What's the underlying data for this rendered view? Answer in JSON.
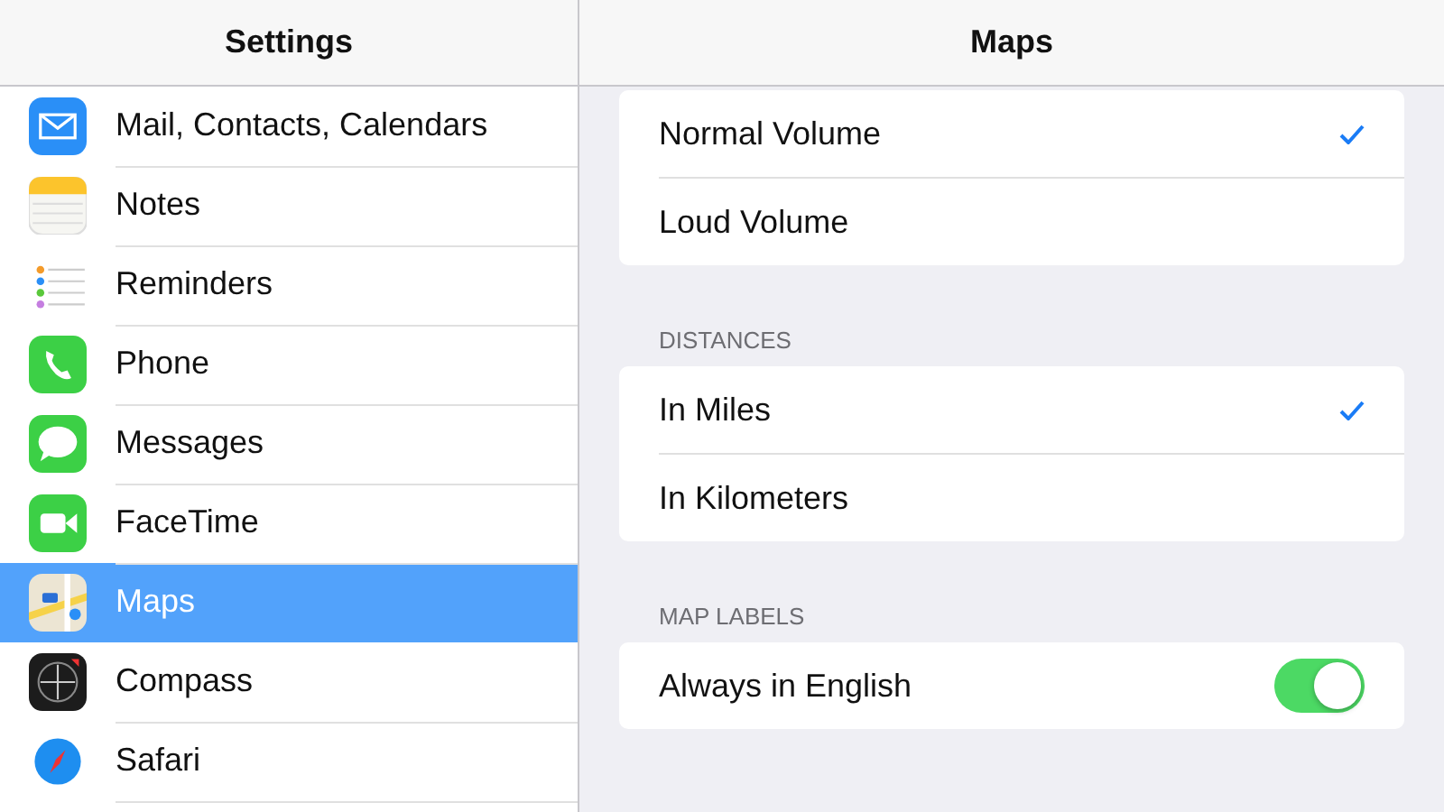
{
  "sidebar": {
    "title": "Settings",
    "items": [
      {
        "label": "Mail, Contacts, Calendars",
        "selected": false
      },
      {
        "label": "Notes",
        "selected": false
      },
      {
        "label": "Reminders",
        "selected": false
      },
      {
        "label": "Phone",
        "selected": false
      },
      {
        "label": "Messages",
        "selected": false
      },
      {
        "label": "FaceTime",
        "selected": false
      },
      {
        "label": "Maps",
        "selected": true
      },
      {
        "label": "Compass",
        "selected": false
      },
      {
        "label": "Safari",
        "selected": false
      }
    ]
  },
  "detail": {
    "title": "Maps",
    "groups": [
      {
        "rows": [
          {
            "kind": "check",
            "label": "Normal Volume",
            "selected": true
          },
          {
            "kind": "check",
            "label": "Loud Volume",
            "selected": false
          }
        ]
      },
      {
        "header": "DISTANCES",
        "rows": [
          {
            "kind": "check",
            "label": "In Miles",
            "selected": true
          },
          {
            "kind": "check",
            "label": "In Kilometers",
            "selected": false
          }
        ]
      },
      {
        "header": "MAP LABELS",
        "rows": [
          {
            "kind": "toggle",
            "label": "Always in English",
            "on": true
          }
        ]
      }
    ]
  }
}
